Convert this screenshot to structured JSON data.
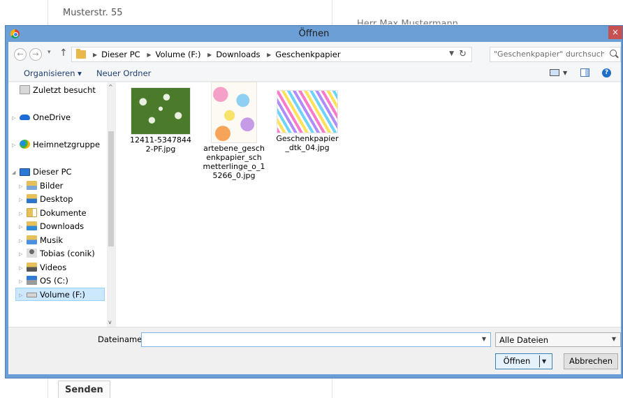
{
  "background": {
    "address": "Musterstr. 55",
    "recipient": "Herr Max Mustermann",
    "send_label": "Senden"
  },
  "dialog": {
    "title": "Öffnen",
    "close_label": "×"
  },
  "breadcrumb": [
    "Dieser PC",
    "Volume (F:)",
    "Downloads",
    "Geschenkpapier"
  ],
  "search": {
    "placeholder": "\"Geschenkpapier\" durchsuchen"
  },
  "toolbar": {
    "organize_label": "Organisieren ▾",
    "new_folder_label": "Neuer Ordner",
    "help_label": "?"
  },
  "nav": {
    "items": [
      {
        "label": "Zuletzt besucht",
        "icon": "recent-icon"
      },
      {
        "label": "OneDrive",
        "icon": "cloud-icon"
      },
      {
        "label": "Heimnetzgruppe",
        "icon": "homegroup-icon"
      },
      {
        "label": "Dieser PC",
        "icon": "computer-icon"
      },
      {
        "label": "Bilder",
        "icon": "pictures-folder-icon"
      },
      {
        "label": "Desktop",
        "icon": "desktop-folder-icon"
      },
      {
        "label": "Dokumente",
        "icon": "documents-folder-icon"
      },
      {
        "label": "Downloads",
        "icon": "downloads-folder-icon"
      },
      {
        "label": "Musik",
        "icon": "music-folder-icon"
      },
      {
        "label": "Tobias (conik)",
        "icon": "user-folder-icon"
      },
      {
        "label": "Videos",
        "icon": "videos-folder-icon"
      },
      {
        "label": "OS (C:)",
        "icon": "drive-c-icon"
      },
      {
        "label": "Volume (F:)",
        "icon": "drive-f-icon"
      }
    ]
  },
  "files": [
    {
      "name": "12411-53478442-PF.jpg"
    },
    {
      "name": "artebene_geschenkpapier_schmetterlinge_o_15266_0.jpg"
    },
    {
      "name": "Geschenkpapier_dtk_04.jpg"
    }
  ],
  "bottom": {
    "filename_label": "Dateiname:",
    "filename_value": "",
    "filter_value": "Alle Dateien",
    "open_label": "Öffnen",
    "cancel_label": "Abbrechen"
  },
  "colors": {
    "titlebar": "#6d9fd7",
    "close": "#c75050",
    "selection": "#cce8ff"
  }
}
